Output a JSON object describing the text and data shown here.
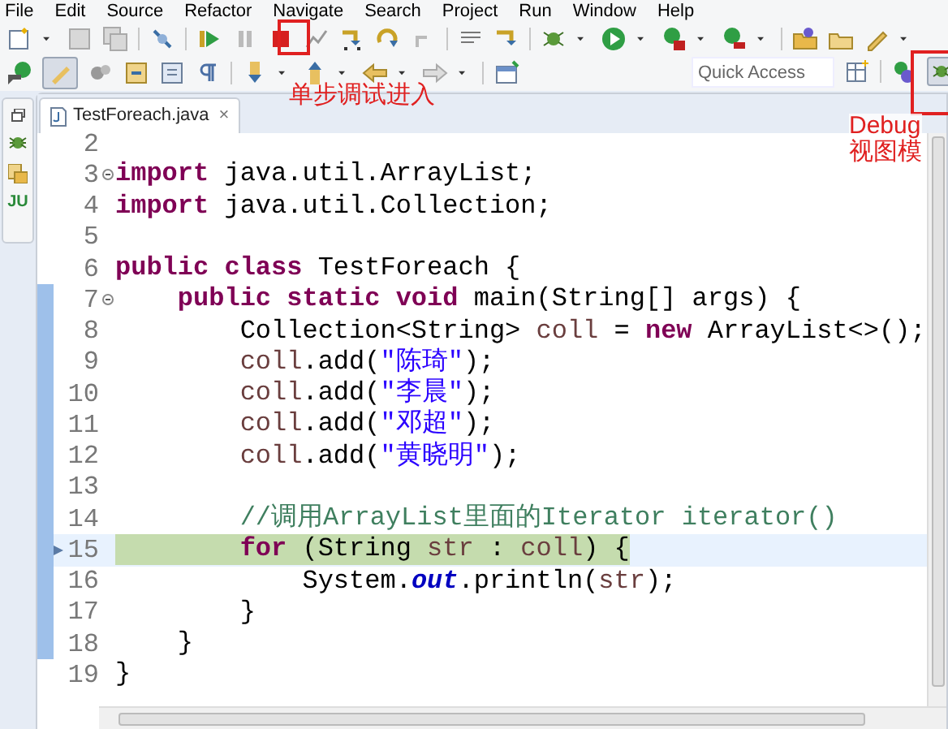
{
  "menu": [
    "File",
    "Edit",
    "Source",
    "Refactor",
    "Navigate",
    "Search",
    "Project",
    "Run",
    "Window",
    "Help"
  ],
  "side_icon_label": "JU",
  "quick_access": {
    "placeholder": "Quick Access"
  },
  "editor_tab": {
    "title": "TestForeach.java",
    "close": "×",
    "selected": true
  },
  "code_lines": [
    {
      "number": "2",
      "fold": false,
      "changed": false,
      "current": false
    },
    {
      "number": "3",
      "fold": true,
      "changed": false,
      "current": false,
      "tokens": [
        {
          "kind": "kw",
          "t": "import"
        },
        {
          "kind": "plain",
          "t": " java.util.ArrayList;"
        }
      ]
    },
    {
      "number": "4",
      "fold": false,
      "changed": false,
      "current": false,
      "tokens": [
        {
          "kind": "kw",
          "t": "import"
        },
        {
          "kind": "plain",
          "t": " java.util.Collection;"
        }
      ]
    },
    {
      "number": "5",
      "fold": false,
      "changed": false,
      "current": false
    },
    {
      "number": "6",
      "fold": false,
      "changed": false,
      "current": false,
      "tokens": [
        {
          "kind": "kw",
          "t": "public class"
        },
        {
          "kind": "plain",
          "t": " TestForeach {"
        }
      ]
    },
    {
      "number": "7",
      "fold": true,
      "changed": true,
      "current": false,
      "tokens": [
        {
          "kind": "kw",
          "t": "    public static void"
        },
        {
          "kind": "plain",
          "t": " main(String[] args) {"
        }
      ]
    },
    {
      "number": "8",
      "fold": false,
      "changed": true,
      "current": false,
      "tokens": [
        {
          "kind": "plain",
          "t": "        Collection<String> "
        },
        {
          "kind": "var",
          "t": "coll"
        },
        {
          "kind": "plain",
          "t": " = "
        },
        {
          "kind": "kw",
          "t": "new"
        },
        {
          "kind": "plain",
          "t": " ArrayList<>();"
        }
      ]
    },
    {
      "number": "9",
      "fold": false,
      "changed": true,
      "current": false,
      "tokens": [
        {
          "kind": "var",
          "t": "        coll"
        },
        {
          "kind": "plain",
          "t": ".add("
        },
        {
          "kind": "str",
          "t": "\"陈琦\""
        },
        {
          "kind": "plain",
          "t": ");"
        }
      ]
    },
    {
      "number": "10",
      "fold": false,
      "changed": true,
      "current": false,
      "tokens": [
        {
          "kind": "var",
          "t": "        coll"
        },
        {
          "kind": "plain",
          "t": ".add("
        },
        {
          "kind": "str",
          "t": "\"李晨\""
        },
        {
          "kind": "plain",
          "t": ");"
        }
      ]
    },
    {
      "number": "11",
      "fold": false,
      "changed": true,
      "current": false,
      "tokens": [
        {
          "kind": "var",
          "t": "        coll"
        },
        {
          "kind": "plain",
          "t": ".add("
        },
        {
          "kind": "str",
          "t": "\"邓超\""
        },
        {
          "kind": "plain",
          "t": ");"
        }
      ]
    },
    {
      "number": "12",
      "fold": false,
      "changed": true,
      "current": false,
      "tokens": [
        {
          "kind": "var",
          "t": "        coll"
        },
        {
          "kind": "plain",
          "t": ".add("
        },
        {
          "kind": "str",
          "t": "\"黄晓明\""
        },
        {
          "kind": "plain",
          "t": ");"
        }
      ]
    },
    {
      "number": "13",
      "fold": false,
      "changed": true,
      "current": false
    },
    {
      "number": "14",
      "fold": false,
      "changed": true,
      "current": false,
      "tokens": [
        {
          "kind": "comment",
          "t": "        //调用ArrayList里面的Iterator iterator()"
        }
      ]
    },
    {
      "number": "15",
      "fold": false,
      "changed": true,
      "current": true,
      "tokens": [
        {
          "kind": "kw",
          "t": "        for"
        },
        {
          "kind": "plain",
          "t": " (String "
        },
        {
          "kind": "var",
          "t": "str"
        },
        {
          "kind": "plain",
          "t": " : "
        },
        {
          "kind": "var",
          "t": "coll"
        },
        {
          "kind": "plain",
          "t": ") {"
        }
      ]
    },
    {
      "number": "16",
      "fold": false,
      "changed": true,
      "current": false,
      "tokens": [
        {
          "kind": "plain",
          "t": "            System."
        },
        {
          "kind": "field",
          "t": "out"
        },
        {
          "kind": "plain",
          "t": ".println("
        },
        {
          "kind": "var",
          "t": "str"
        },
        {
          "kind": "plain",
          "t": ");"
        }
      ]
    },
    {
      "number": "17",
      "fold": false,
      "changed": true,
      "current": false,
      "tokens": [
        {
          "kind": "plain",
          "t": "        }"
        }
      ]
    },
    {
      "number": "18",
      "fold": false,
      "changed": true,
      "current": false,
      "tokens": [
        {
          "kind": "plain",
          "t": "    }"
        }
      ]
    },
    {
      "number": "19",
      "fold": false,
      "changed": false,
      "current": false,
      "tokens": [
        {
          "kind": "plain",
          "t": "}"
        }
      ]
    }
  ],
  "annotations": [
    {
      "kind": "step",
      "text": "单步调试进入"
    },
    {
      "kind": "debug",
      "lines": [
        "Debug",
        "视图模"
      ]
    }
  ]
}
